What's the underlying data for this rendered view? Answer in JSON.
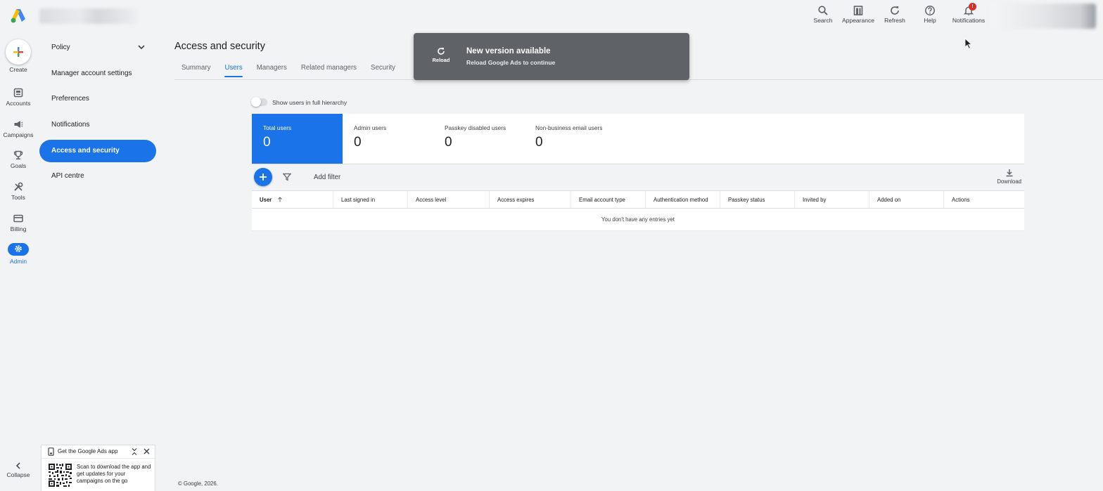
{
  "topbar": {
    "actions": [
      {
        "label": "Search",
        "icon": "search-icon"
      },
      {
        "label": "Appearance",
        "icon": "appearance-icon"
      },
      {
        "label": "Refresh",
        "icon": "refresh-icon"
      },
      {
        "label": "Help",
        "icon": "help-icon"
      },
      {
        "label": "Notifications",
        "icon": "bell-icon",
        "badge": "!"
      }
    ]
  },
  "rail": {
    "create_label": "Create",
    "items": [
      {
        "label": "Accounts",
        "icon": "accounts-icon"
      },
      {
        "label": "Campaigns",
        "icon": "campaigns-icon"
      },
      {
        "label": "Goals",
        "icon": "trophy-icon"
      },
      {
        "label": "Tools",
        "icon": "tools-icon"
      },
      {
        "label": "Billing",
        "icon": "billing-icon"
      },
      {
        "label": "Admin",
        "icon": "gear-icon",
        "active": true
      }
    ],
    "collapse_label": "Collapse"
  },
  "sidenav": {
    "items": [
      {
        "label": "Policy",
        "expandable": true
      },
      {
        "label": "Manager account settings"
      },
      {
        "label": "Preferences"
      },
      {
        "label": "Notifications"
      },
      {
        "label": "Access and security",
        "active": true
      },
      {
        "label": "API centre"
      }
    ]
  },
  "page": {
    "title": "Access and security",
    "tabs": [
      {
        "label": "Summary"
      },
      {
        "label": "Users",
        "active": true
      },
      {
        "label": "Managers"
      },
      {
        "label": "Related managers"
      },
      {
        "label": "Security"
      }
    ]
  },
  "toast": {
    "reload_label": "Reload",
    "title": "New version available",
    "subtitle": "Reload Google Ads to continue"
  },
  "hierarchy_toggle": {
    "label": "Show users in full hierarchy",
    "on": false
  },
  "summary_cards": [
    {
      "label": "Total users",
      "value": "0",
      "active": true
    },
    {
      "label": "Admin users",
      "value": "0"
    },
    {
      "label": "Passkey disabled users",
      "value": "0"
    },
    {
      "label": "Non-business email users",
      "value": "0"
    }
  ],
  "table": {
    "add_filter_label": "Add filter",
    "download_label": "Download",
    "columns": [
      {
        "label": "User",
        "sorted": "asc"
      },
      {
        "label": "Last signed in"
      },
      {
        "label": "Access level"
      },
      {
        "label": "Access expires"
      },
      {
        "label": "Email account type"
      },
      {
        "label": "Authentication method"
      },
      {
        "label": "Passkey status"
      },
      {
        "label": "Invited by"
      },
      {
        "label": "Added on"
      },
      {
        "label": "Actions"
      }
    ],
    "empty_message": "You don't have any entries yet"
  },
  "promo": {
    "title": "Get the Google Ads app",
    "text": "Scan to download the app and get updates for your campaigns on the go"
  },
  "footer": {
    "copyright": "© Google, 2026."
  },
  "colors": {
    "accent": "#1a73e8",
    "background": "#f1f3f4",
    "toast": "#5f6368",
    "badge": "#d93025"
  }
}
